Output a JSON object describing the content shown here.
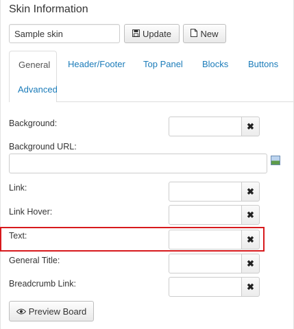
{
  "header": {
    "title": "Skin Information"
  },
  "skin": {
    "name_value": "Sample skin"
  },
  "toolbar": {
    "update_label": "Update",
    "new_label": "New"
  },
  "tabs": [
    {
      "label": "General",
      "active": true
    },
    {
      "label": "Header/Footer"
    },
    {
      "label": "Top Panel"
    },
    {
      "label": "Blocks"
    },
    {
      "label": "Buttons"
    },
    {
      "label": "Advanced"
    }
  ],
  "fields": {
    "background": {
      "label": "Background:",
      "value": ""
    },
    "background_url": {
      "label": "Background URL:",
      "value": ""
    },
    "link": {
      "label": "Link:",
      "value": ""
    },
    "link_hover": {
      "label": "Link Hover:",
      "value": ""
    },
    "text": {
      "label": "Text:",
      "value": ""
    },
    "general_title": {
      "label": "General Title:",
      "value": ""
    },
    "breadcrumb_link": {
      "label": "Breadcrumb Link:",
      "value": ""
    }
  },
  "clear_glyph": "✖",
  "preview": {
    "label": "Preview Board"
  },
  "icons": {
    "update": "save-icon",
    "new": "new-document-icon",
    "clear": "close-icon",
    "picture": "image-picker-icon",
    "preview": "eye-icon"
  },
  "colors": {
    "link": "#1a7bb9",
    "highlight_border": "#d7191c"
  }
}
